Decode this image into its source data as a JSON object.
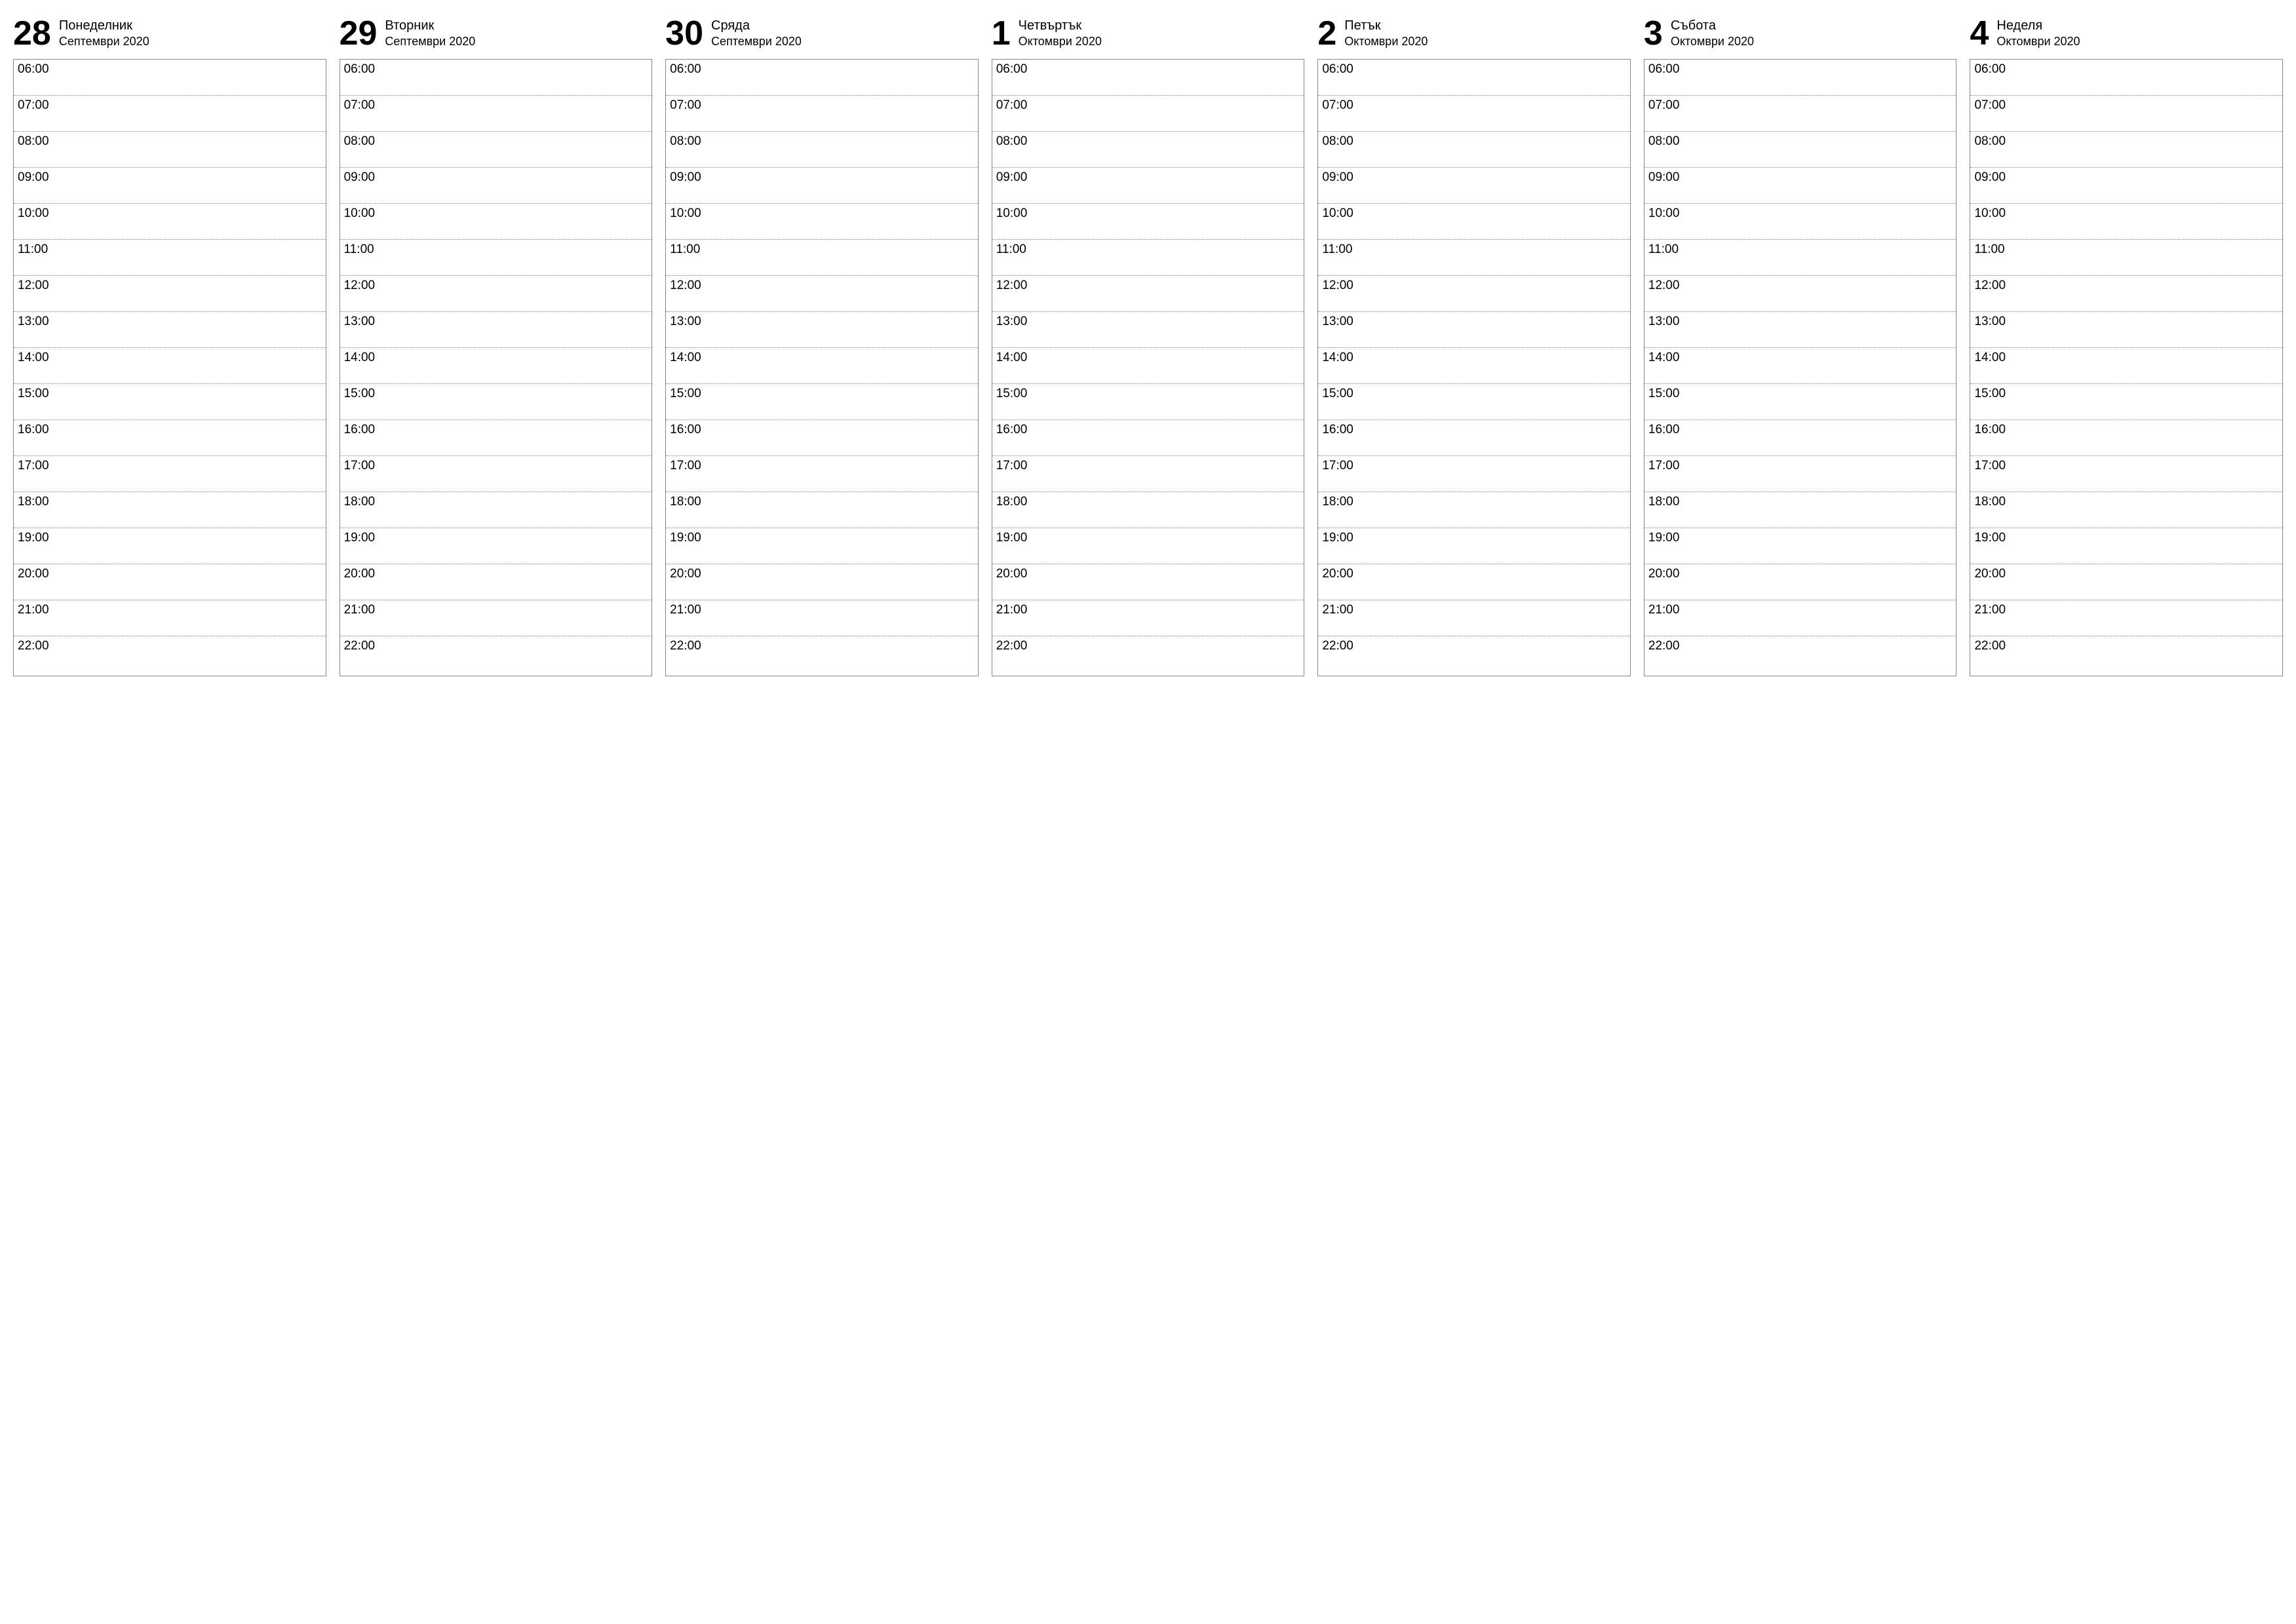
{
  "days": [
    {
      "number": "28",
      "name": "Понеделник",
      "month": "Септември 2020"
    },
    {
      "number": "29",
      "name": "Вторник",
      "month": "Септември 2020"
    },
    {
      "number": "30",
      "name": "Сряда",
      "month": "Септември 2020"
    },
    {
      "number": "1",
      "name": "Четвъртък",
      "month": "Октомври 2020"
    },
    {
      "number": "2",
      "name": "Петък",
      "month": "Октомври 2020"
    },
    {
      "number": "3",
      "name": "Събота",
      "month": "Октомври 2020"
    },
    {
      "number": "4",
      "name": "Неделя",
      "month": "Октомври 2020"
    }
  ],
  "timeSlots": [
    "06:00",
    "07:00",
    "08:00",
    "09:00",
    "10:00",
    "11:00",
    "12:00",
    "13:00",
    "14:00",
    "15:00",
    "16:00",
    "17:00",
    "18:00",
    "19:00",
    "20:00",
    "21:00",
    "22:00"
  ]
}
